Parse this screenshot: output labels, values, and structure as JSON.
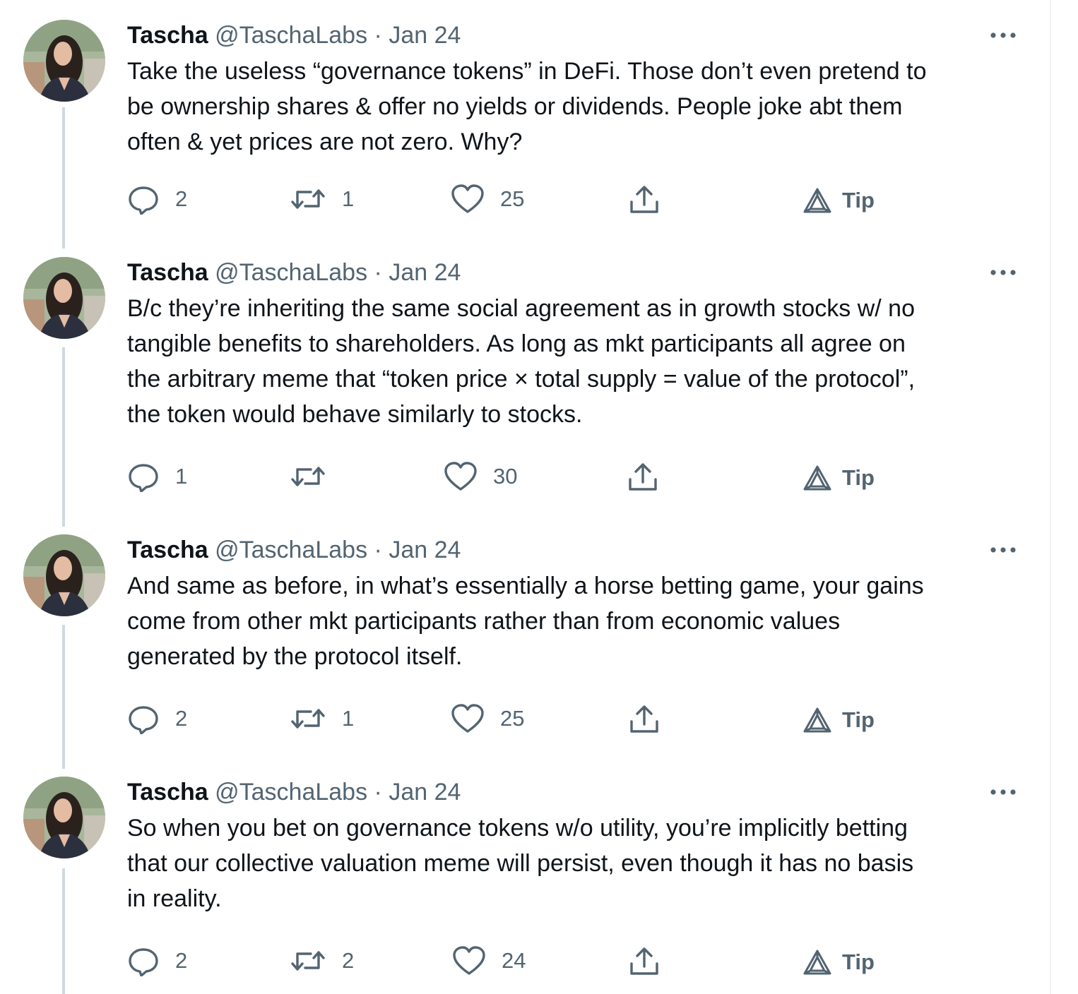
{
  "tweets": [
    {
      "name": "Tascha",
      "handle": "@TaschaLabs",
      "separator": "·",
      "date": "Jan 24",
      "lines": [
        "Take the useless “governance tokens” in DeFi. Those don’t even pretend to",
        "be ownership shares & offer no yields or dividends. People joke abt them",
        "often & yet prices are not zero. Why?"
      ],
      "replies": "2",
      "retweets": "1",
      "likes": "25",
      "tip": "Tip"
    },
    {
      "name": "Tascha",
      "handle": "@TaschaLabs",
      "separator": "·",
      "date": "Jan 24",
      "lines": [
        "B/c they’re inheriting the same social agreement as in growth stocks w/ no",
        "tangible benefits to shareholders. As long as mkt participants all agree on",
        "the arbitrary meme that “token price × total supply = value of the protocol”,",
        "the token would behave similarly to stocks."
      ],
      "replies": "1",
      "retweets": "",
      "likes": "30",
      "tip": "Tip"
    },
    {
      "name": "Tascha",
      "handle": "@TaschaLabs",
      "separator": "·",
      "date": "Jan 24",
      "lines": [
        "And same as before, in what’s essentially a horse betting game, your gains",
        "come from other mkt participants rather than from economic values",
        "generated by the protocol itself."
      ],
      "replies": "2",
      "retweets": "1",
      "likes": "25",
      "tip": "Tip"
    },
    {
      "name": "Tascha",
      "handle": "@TaschaLabs",
      "separator": "·",
      "date": "Jan 24",
      "lines": [
        "So when you bet on governance tokens w/o utility, you’re implicitly betting",
        "that our collective valuation meme will persist, even though it has no basis",
        "in reality."
      ],
      "replies": "2",
      "retweets": "2",
      "likes": "24",
      "tip": "Tip"
    }
  ],
  "icons": {
    "reply": "reply-icon",
    "retweet": "retweet-icon",
    "like": "heart-icon",
    "share": "share-icon",
    "tip": "tip-icon",
    "more": "more-icon"
  },
  "colors": {
    "text": "#0f1419",
    "secondary": "#536471",
    "thread_line": "#cfd9de"
  }
}
